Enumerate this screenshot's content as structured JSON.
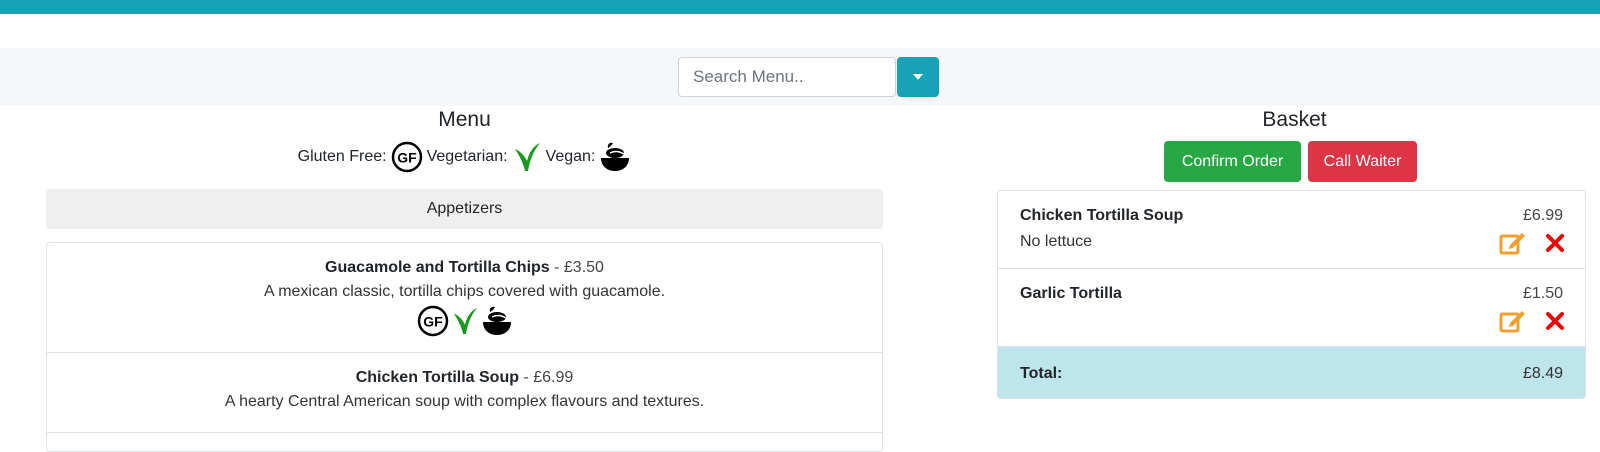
{
  "search": {
    "placeholder": "Search Menu..",
    "value": ""
  },
  "menu": {
    "title": "Menu",
    "legend": {
      "gluten_free_label": "Gluten Free:",
      "vegetarian_label": "Vegetarian:",
      "vegan_label": "Vegan:"
    },
    "section": "Appetizers",
    "items": [
      {
        "name": "Guacamole and Tortilla Chips",
        "price": "£3.50",
        "separator": " - ",
        "description": "A mexican classic, tortilla chips covered with guacamole.",
        "icons": [
          "gluten-free-icon",
          "vegetarian-icon",
          "vegan-icon"
        ]
      },
      {
        "name": "Chicken Tortilla Soup",
        "price": "£6.99",
        "separator": " - ",
        "description": "A hearty Central American soup with complex flavours and textures.",
        "icons": []
      }
    ]
  },
  "basket": {
    "title": "Basket",
    "confirm_label": "Confirm Order",
    "call_waiter_label": "Call Waiter",
    "items": [
      {
        "name": "Chicken Tortilla Soup",
        "note": "No lettuce",
        "price": "£6.99"
      },
      {
        "name": "Garlic Tortilla",
        "note": "",
        "price": "£1.50"
      }
    ],
    "total_label": "Total:",
    "total_value": "£8.49"
  },
  "colors": {
    "accent": "#17a2b8",
    "confirm": "#28a745",
    "danger": "#dc3545",
    "edit": "#f0a030",
    "delete": "#ee0000",
    "total_bg": "#bee5eb"
  }
}
